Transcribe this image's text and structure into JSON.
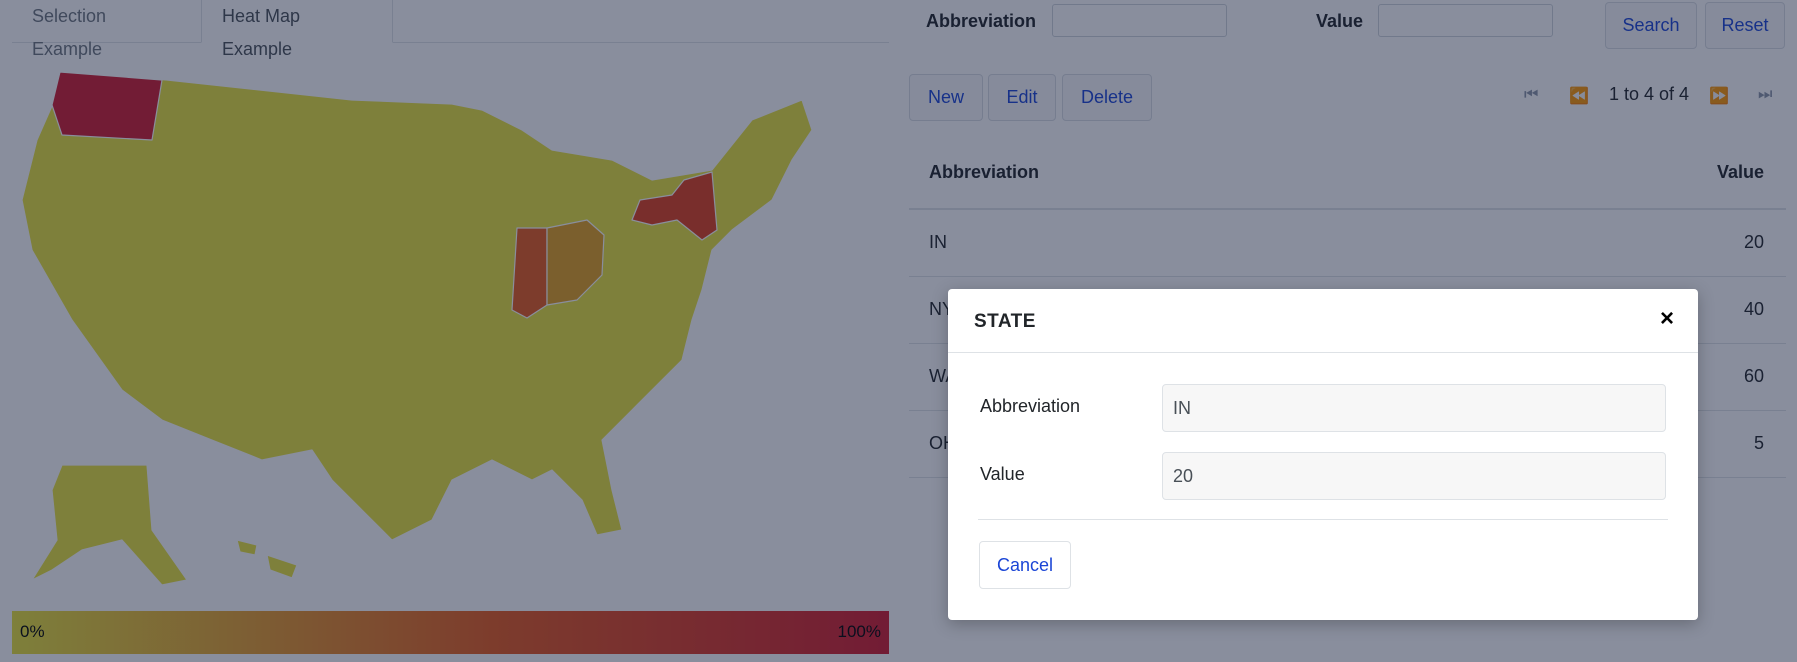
{
  "tabs": {
    "selection": "Selection Example",
    "heatmap": "Heat Map Example"
  },
  "legend": {
    "min": "0%",
    "max": "100%"
  },
  "map": {
    "colors": {
      "base": "#e8e23a",
      "in": "#e65a1d",
      "oh": "#e3a11f",
      "ny": "#de3f1c",
      "wa": "#d11a2e",
      "border": "#ffffff"
    }
  },
  "search": {
    "abbreviation_label": "Abbreviation",
    "value_label": "Value",
    "search_btn": "Search",
    "reset_btn": "Reset"
  },
  "toolbar": {
    "new": "New",
    "edit": "Edit",
    "delete": "Delete",
    "range": "1 to 4 of 4"
  },
  "table": {
    "headers": {
      "abbreviation": "Abbreviation",
      "value": "Value"
    },
    "rows": [
      {
        "abbreviation": "IN",
        "value": "20"
      },
      {
        "abbreviation": "NY",
        "value": "40"
      },
      {
        "abbreviation": "WA",
        "value": "60"
      },
      {
        "abbreviation": "OH",
        "value": "5"
      }
    ]
  },
  "modal": {
    "title": "STATE",
    "close": "×",
    "abbreviation_label": "Abbreviation",
    "abbreviation_value": "IN",
    "value_label": "Value",
    "value_value": "20",
    "cancel": "Cancel"
  },
  "accent": "#1a45d6"
}
